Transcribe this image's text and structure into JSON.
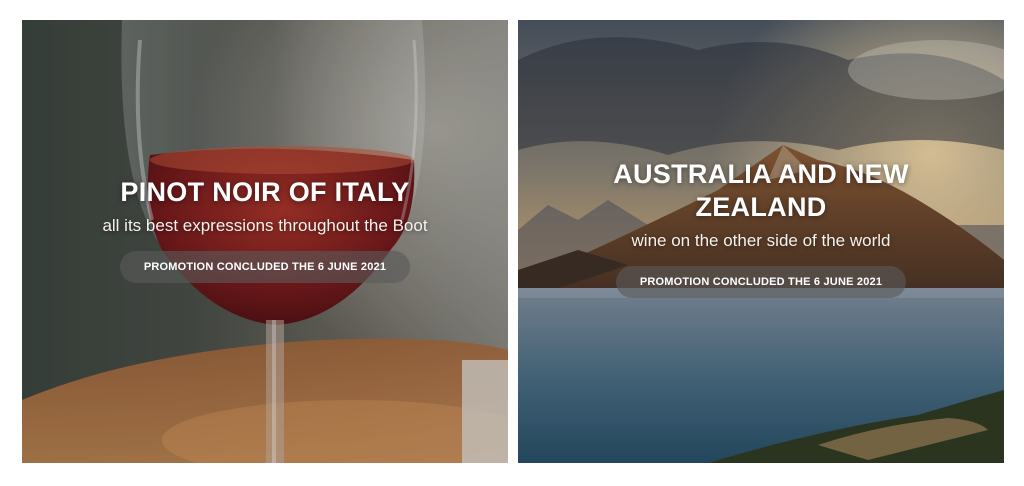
{
  "promotions": [
    {
      "title": "PINOT NOIR OF ITALY",
      "subtitle": "all its best expressions throughout the Boot",
      "status": "PROMOTION CONCLUDED THE 6 JUNE 2021",
      "image": "red-wine-glass-photo"
    },
    {
      "title": "AUSTRALIA AND NEW ZEALAND",
      "subtitle": "wine on the other side of the world",
      "status": "PROMOTION CONCLUDED THE 6 JUNE 2021",
      "image": "mountain-lake-landscape-photo"
    }
  ]
}
